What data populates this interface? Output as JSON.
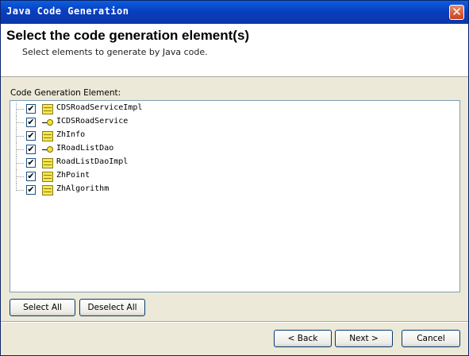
{
  "window": {
    "title": "Java Code Generation",
    "close_symbol": "✕"
  },
  "banner": {
    "title": "Select the code generation element(s)",
    "subtitle": "Select elements to generate by Java code."
  },
  "tree": {
    "label": "Code Generation Element:",
    "items": [
      {
        "label": "CDSRoadServiceImpl",
        "kind": "class",
        "checked": true
      },
      {
        "label": "ICDSRoadService",
        "kind": "interface",
        "checked": true
      },
      {
        "label": "ZhInfo",
        "kind": "class",
        "checked": true
      },
      {
        "label": "IRoadListDao",
        "kind": "interface",
        "checked": true
      },
      {
        "label": "RoadListDaoImpl",
        "kind": "class",
        "checked": true
      },
      {
        "label": "ZhPoint",
        "kind": "class",
        "checked": true
      },
      {
        "label": "ZhAlgorithm",
        "kind": "class",
        "checked": true
      }
    ],
    "check_mark": "✔"
  },
  "buttons": {
    "select_all": "Select All",
    "deselect_all": "Deselect All",
    "back": "< Back",
    "next": "Next >",
    "cancel": "Cancel"
  }
}
